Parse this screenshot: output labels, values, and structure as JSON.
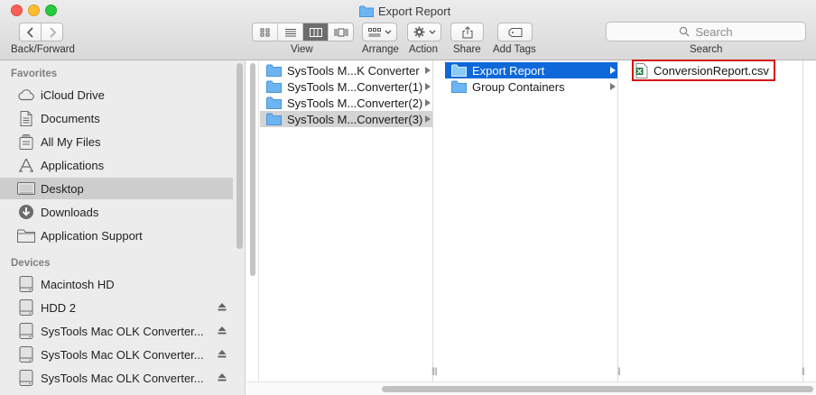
{
  "window": {
    "title": "Export Report"
  },
  "toolbar": {
    "back_forward_label": "Back/Forward",
    "view_label": "View",
    "arrange_label": "Arrange",
    "action_label": "Action",
    "share_label": "Share",
    "add_tags_label": "Add Tags",
    "search_label": "Search",
    "search_placeholder": "Search"
  },
  "sidebar": {
    "favorites_heading": "Favorites",
    "favorites": [
      {
        "label": "iCloud Drive",
        "icon": "cloud-icon"
      },
      {
        "label": "Documents",
        "icon": "document-icon"
      },
      {
        "label": "All My Files",
        "icon": "all-files-icon"
      },
      {
        "label": "Applications",
        "icon": "applications-icon"
      },
      {
        "label": "Desktop",
        "icon": "desktop-icon",
        "selected": true
      },
      {
        "label": "Downloads",
        "icon": "downloads-icon"
      },
      {
        "label": "Application Support",
        "icon": "folder-icon"
      }
    ],
    "devices_heading": "Devices",
    "devices": [
      {
        "label": "Macintosh HD",
        "icon": "disk-icon"
      },
      {
        "label": "HDD 2",
        "icon": "disk-icon",
        "eject": true
      },
      {
        "label": "SysTools Mac OLK Converter...",
        "icon": "disk-icon",
        "eject": true
      },
      {
        "label": "SysTools Mac OLK Converter...",
        "icon": "disk-icon",
        "eject": true
      },
      {
        "label": "SysTools Mac OLK Converter...",
        "icon": "disk-icon",
        "eject": true
      }
    ]
  },
  "columns": {
    "col1": [
      {
        "label": "SysTools M...K Converter"
      },
      {
        "label": "SysTools M...Converter(1)"
      },
      {
        "label": "SysTools M...Converter(2)"
      },
      {
        "label": "SysTools M...Converter(3)",
        "selected": true
      }
    ],
    "col2": [
      {
        "label": "Export Report",
        "selected": true
      },
      {
        "label": "Group Containers"
      }
    ],
    "col3": [
      {
        "label": "ConversionReport.csv"
      }
    ]
  },
  "colors": {
    "selection_blue": "#0f68d9",
    "highlight_red": "#d21414",
    "folder_blue": "#6cb5f2"
  }
}
